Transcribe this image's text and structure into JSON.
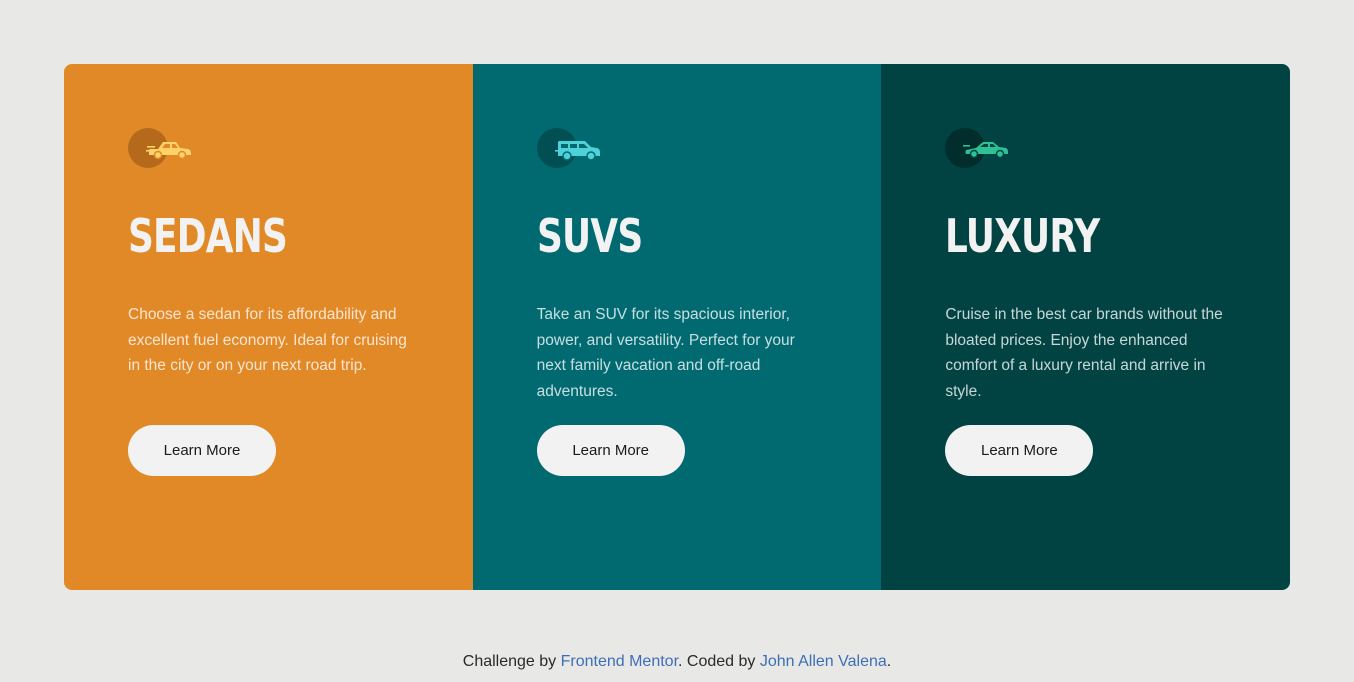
{
  "cards": [
    {
      "icon": "sedan-car-icon",
      "title": "Sedans",
      "description": "Choose a sedan for its affordability and excellent fuel economy. Ideal for cruising in the city or on your next road trip.",
      "button_label": "Learn More",
      "color": "#e28927"
    },
    {
      "icon": "suv-car-icon",
      "title": "SUVs",
      "description": "Take an SUV for its spacious interior, power, and versatility. Perfect for your next family vacation and off-road adventures.",
      "button_label": "Learn More",
      "color": "#016a71"
    },
    {
      "icon": "luxury-car-icon",
      "title": "Luxury",
      "description": "Cruise in the best car brands without the bloated prices. Enjoy the enhanced comfort of a luxury rental and arrive in style.",
      "button_label": "Learn More",
      "color": "#004342"
    }
  ],
  "footer": {
    "prefix": "Challenge by ",
    "link1": "Frontend Mentor",
    "middle": ". Coded by ",
    "link2": "John Allen Valena",
    "suffix": "."
  },
  "colors": {
    "background": "#e8e8e6",
    "button_bg": "#f2f2f2",
    "link": "#3e6fb5"
  }
}
